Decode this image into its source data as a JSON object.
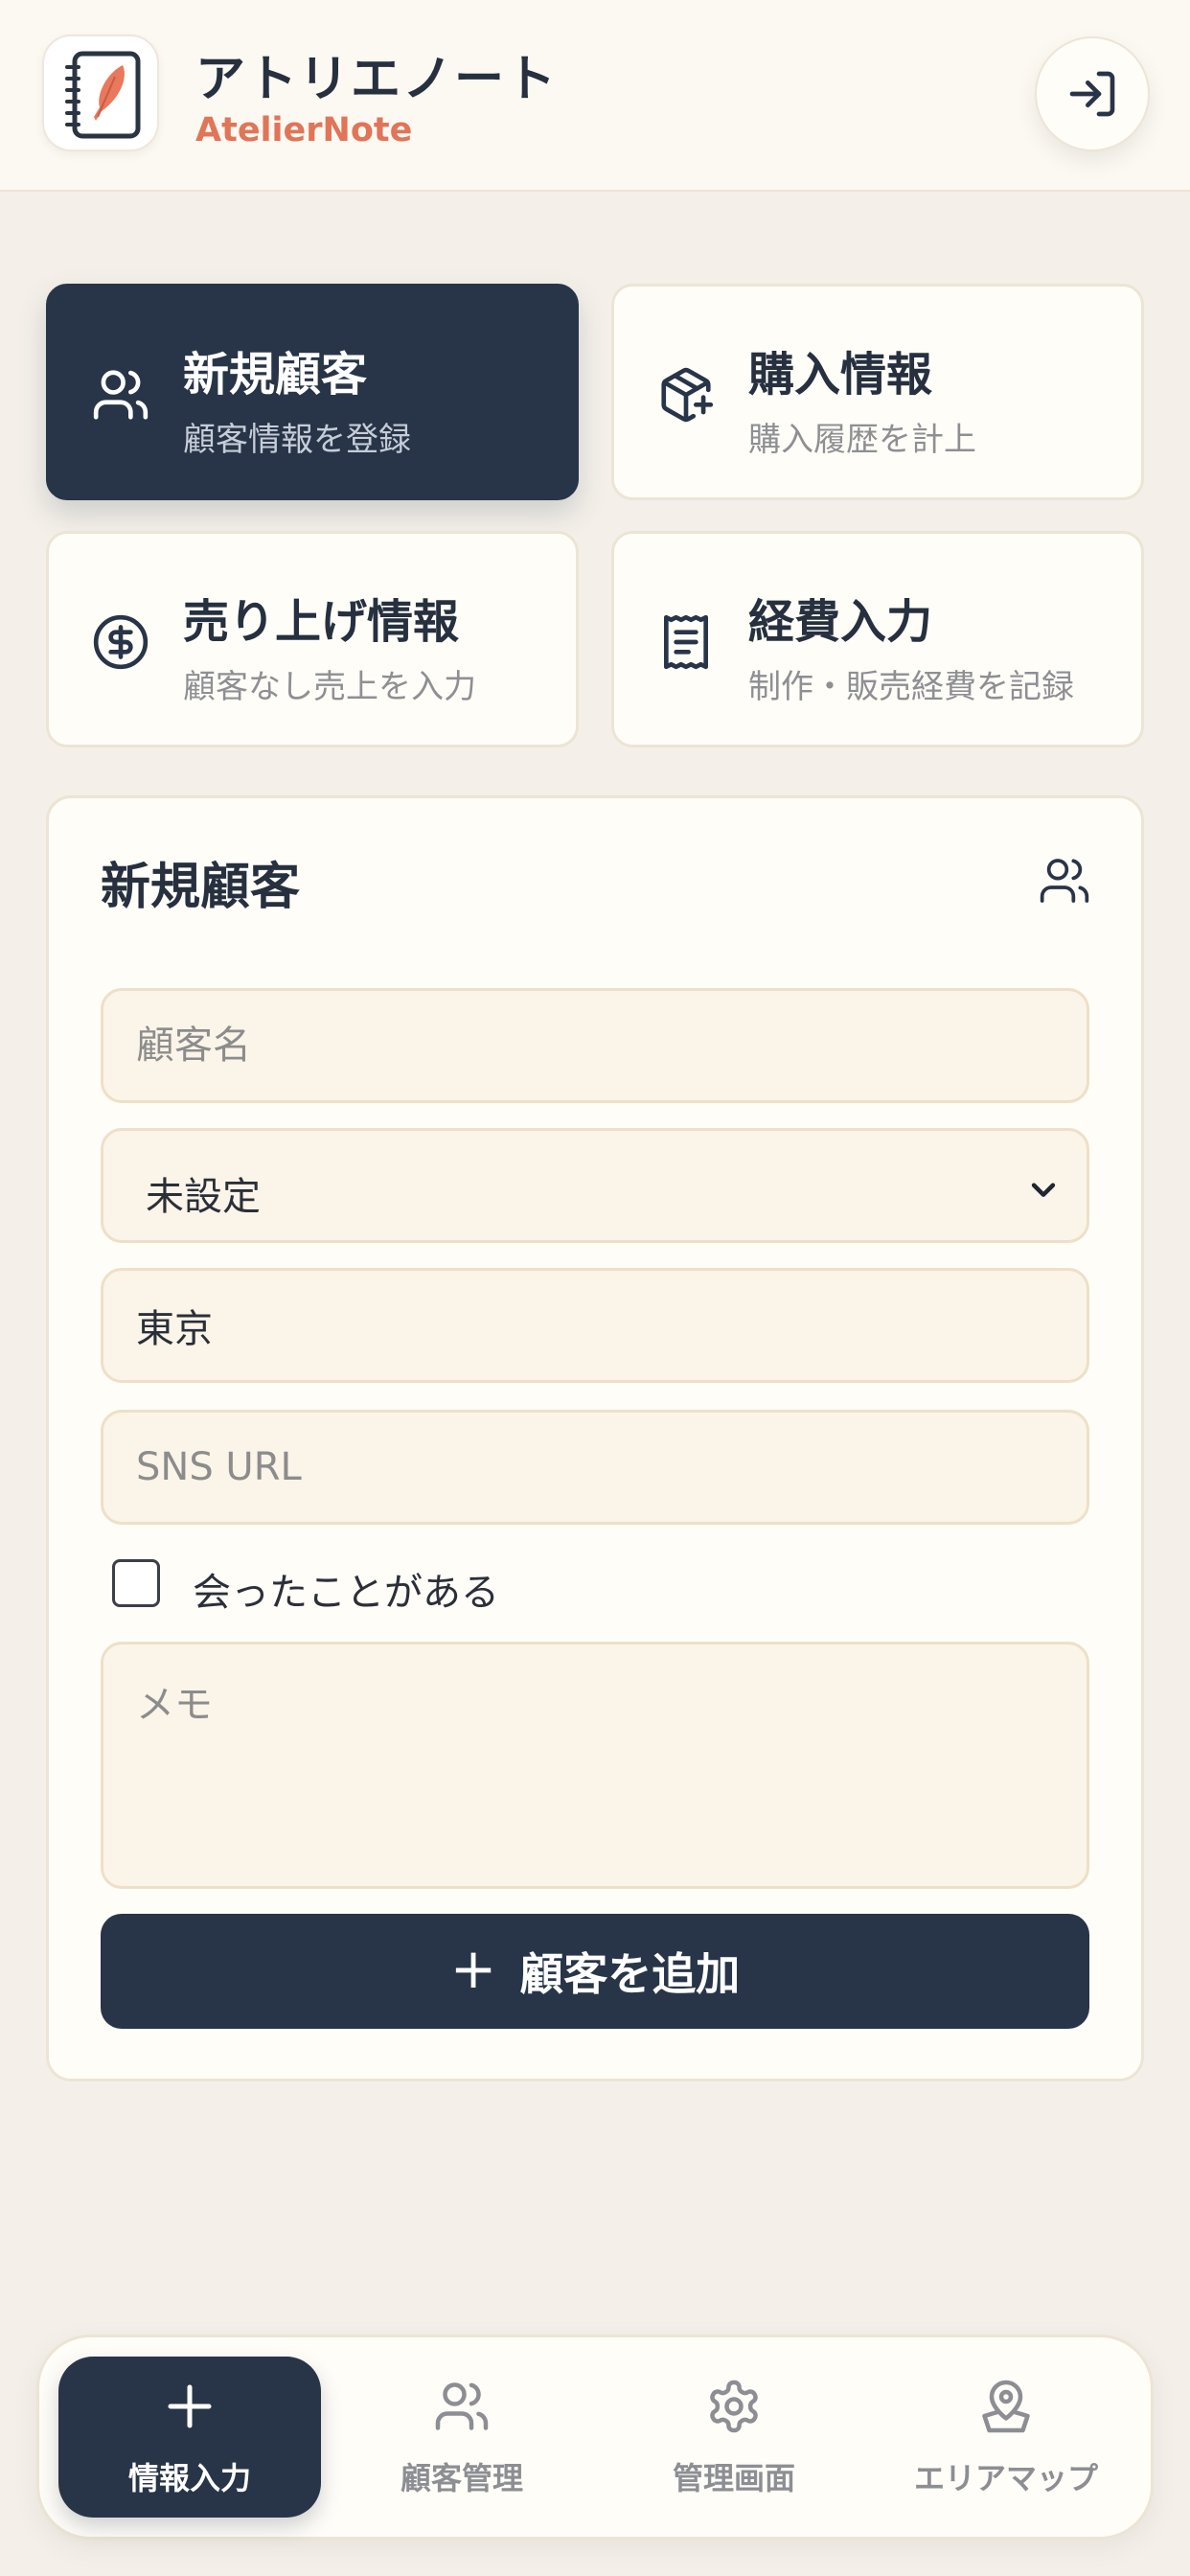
{
  "header": {
    "title": "アトリエノート",
    "subtitle": "AtelierNote",
    "icons": {
      "app": "notebook-quill-icon",
      "login": "log-in-icon"
    }
  },
  "actions": [
    {
      "title": "新規顧客",
      "subtitle": "顧客情報を登録",
      "icon": "users-icon",
      "active": true
    },
    {
      "title": "購入情報",
      "subtitle": "購入履歴を計上",
      "icon": "package-plus-icon",
      "active": false
    },
    {
      "title": "売り上げ情報",
      "subtitle": "顧客なし売上を入力",
      "icon": "dollar-circle-icon",
      "active": false
    },
    {
      "title": "経費入力",
      "subtitle": "制作・販売経費を記録",
      "icon": "receipt-icon",
      "active": false
    }
  ],
  "form": {
    "title": "新規顧客",
    "icon": "users-icon",
    "name_placeholder": "顧客名",
    "name_value": "",
    "select_value": "未設定",
    "area_value": "東京",
    "sns_placeholder": "SNS URL",
    "sns_value": "",
    "met_label": "会ったことがある",
    "met_checked": false,
    "memo_placeholder": "メモ",
    "submit_plus": "+",
    "submit_label": "顧客を追加"
  },
  "nav": [
    {
      "label": "情報入力",
      "icon": "plus-icon",
      "active": true
    },
    {
      "label": "顧客管理",
      "icon": "users-icon",
      "active": false
    },
    {
      "label": "管理画面",
      "icon": "gear-icon",
      "active": false
    },
    {
      "label": "エリアマップ",
      "icon": "map-pin-icon",
      "active": false
    }
  ],
  "colors": {
    "primary": "#283548",
    "accent": "#e07558",
    "background": "#f4f0e9",
    "field_bg": "#fbf4e8"
  }
}
